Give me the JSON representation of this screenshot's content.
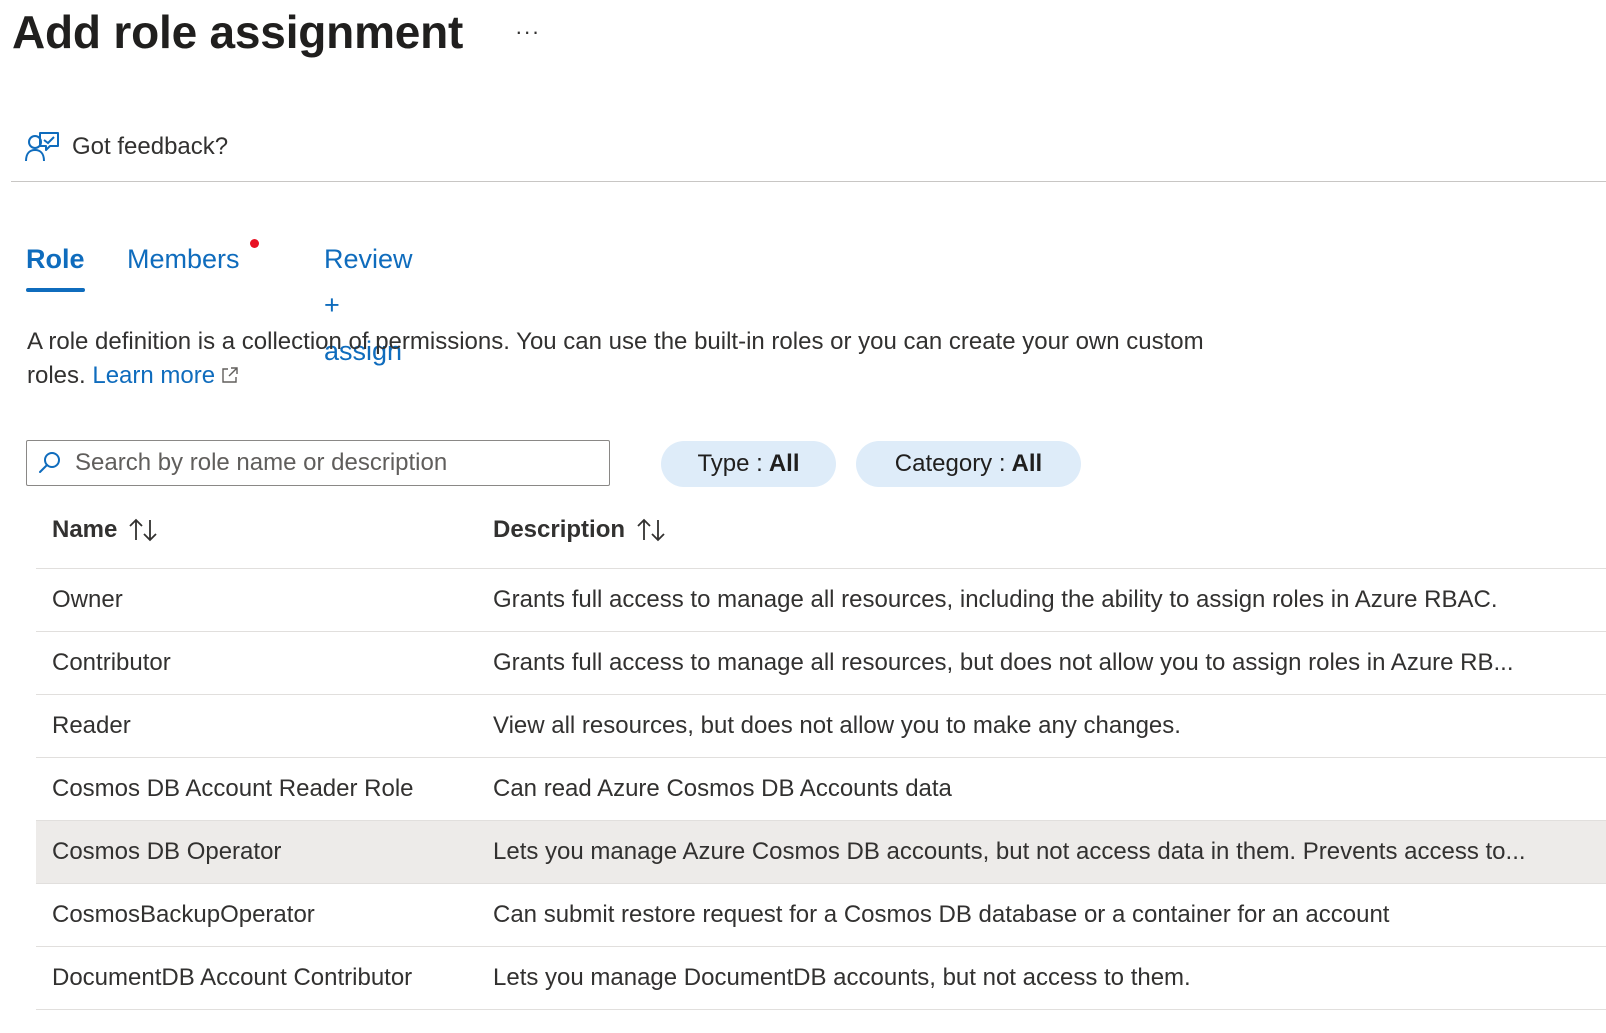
{
  "header": {
    "title": "Add role assignment",
    "more_label": "···"
  },
  "feedback": {
    "label": "Got feedback?",
    "icon": "feedback-icon"
  },
  "tabs": [
    {
      "label": "Role",
      "active": true
    },
    {
      "label": "Members",
      "active": false,
      "has_indicator": true
    },
    {
      "label": "Review + assign",
      "active": false
    }
  ],
  "description": {
    "text": "A role definition is a collection of permissions. You can use the built-in roles or you can create your own custom roles.",
    "link_label": "Learn more",
    "link_icon": "external-link-icon"
  },
  "search": {
    "placeholder": "Search by role name or description",
    "value": "",
    "icon": "search-icon"
  },
  "filters": [
    {
      "label": "Type : ",
      "value": "All"
    },
    {
      "label": "Category : ",
      "value": "All"
    }
  ],
  "table": {
    "columns": [
      {
        "label": "Name",
        "sort_icon": "sort-arrows-icon"
      },
      {
        "label": "Description",
        "sort_icon": "sort-arrows-icon"
      }
    ],
    "rows": [
      {
        "name": "Owner",
        "description": "Grants full access to manage all resources, including the ability to assign roles in Azure RBAC.",
        "selected": false
      },
      {
        "name": "Contributor",
        "description": "Grants full access to manage all resources, but does not allow you to assign roles in Azure RB...",
        "selected": false
      },
      {
        "name": "Reader",
        "description": "View all resources, but does not allow you to make any changes.",
        "selected": false
      },
      {
        "name": "Cosmos DB Account Reader Role",
        "description": "Can read Azure Cosmos DB Accounts data",
        "selected": false
      },
      {
        "name": "Cosmos DB Operator",
        "description": "Lets you manage Azure Cosmos DB accounts, but not access data in them. Prevents access to...",
        "selected": true
      },
      {
        "name": "CosmosBackupOperator",
        "description": "Can submit restore request for a Cosmos DB database or a container for an account",
        "selected": false
      },
      {
        "name": "DocumentDB Account Contributor",
        "description": "Lets you manage DocumentDB accounts, but not access to them.",
        "selected": false
      }
    ]
  },
  "colors": {
    "accent": "#0f6cbd",
    "pill_bg": "#deecf9",
    "selected_row": "#edebe9",
    "indicator": "#e81123"
  }
}
